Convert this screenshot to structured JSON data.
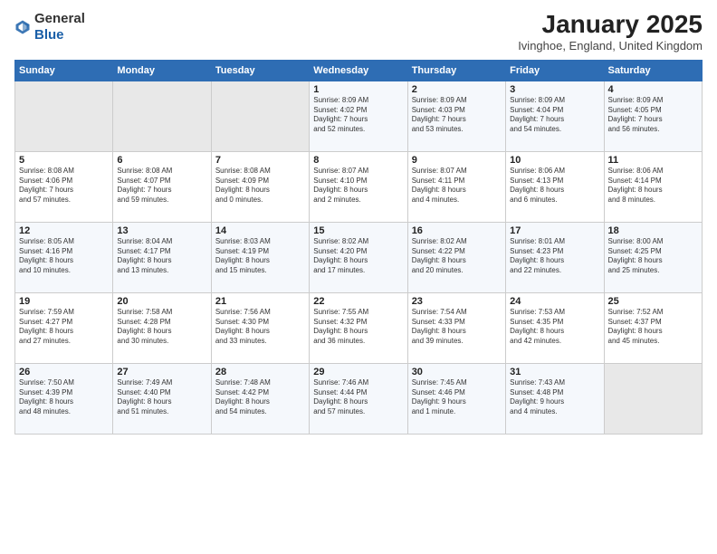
{
  "header": {
    "logo_general": "General",
    "logo_blue": "Blue",
    "title": "January 2025",
    "location": "Ivinghoe, England, United Kingdom"
  },
  "weekdays": [
    "Sunday",
    "Monday",
    "Tuesday",
    "Wednesday",
    "Thursday",
    "Friday",
    "Saturday"
  ],
  "weeks": [
    [
      {
        "day": "",
        "info": ""
      },
      {
        "day": "",
        "info": ""
      },
      {
        "day": "",
        "info": ""
      },
      {
        "day": "1",
        "info": "Sunrise: 8:09 AM\nSunset: 4:02 PM\nDaylight: 7 hours\nand 52 minutes."
      },
      {
        "day": "2",
        "info": "Sunrise: 8:09 AM\nSunset: 4:03 PM\nDaylight: 7 hours\nand 53 minutes."
      },
      {
        "day": "3",
        "info": "Sunrise: 8:09 AM\nSunset: 4:04 PM\nDaylight: 7 hours\nand 54 minutes."
      },
      {
        "day": "4",
        "info": "Sunrise: 8:09 AM\nSunset: 4:05 PM\nDaylight: 7 hours\nand 56 minutes."
      }
    ],
    [
      {
        "day": "5",
        "info": "Sunrise: 8:08 AM\nSunset: 4:06 PM\nDaylight: 7 hours\nand 57 minutes."
      },
      {
        "day": "6",
        "info": "Sunrise: 8:08 AM\nSunset: 4:07 PM\nDaylight: 7 hours\nand 59 minutes."
      },
      {
        "day": "7",
        "info": "Sunrise: 8:08 AM\nSunset: 4:09 PM\nDaylight: 8 hours\nand 0 minutes."
      },
      {
        "day": "8",
        "info": "Sunrise: 8:07 AM\nSunset: 4:10 PM\nDaylight: 8 hours\nand 2 minutes."
      },
      {
        "day": "9",
        "info": "Sunrise: 8:07 AM\nSunset: 4:11 PM\nDaylight: 8 hours\nand 4 minutes."
      },
      {
        "day": "10",
        "info": "Sunrise: 8:06 AM\nSunset: 4:13 PM\nDaylight: 8 hours\nand 6 minutes."
      },
      {
        "day": "11",
        "info": "Sunrise: 8:06 AM\nSunset: 4:14 PM\nDaylight: 8 hours\nand 8 minutes."
      }
    ],
    [
      {
        "day": "12",
        "info": "Sunrise: 8:05 AM\nSunset: 4:16 PM\nDaylight: 8 hours\nand 10 minutes."
      },
      {
        "day": "13",
        "info": "Sunrise: 8:04 AM\nSunset: 4:17 PM\nDaylight: 8 hours\nand 13 minutes."
      },
      {
        "day": "14",
        "info": "Sunrise: 8:03 AM\nSunset: 4:19 PM\nDaylight: 8 hours\nand 15 minutes."
      },
      {
        "day": "15",
        "info": "Sunrise: 8:02 AM\nSunset: 4:20 PM\nDaylight: 8 hours\nand 17 minutes."
      },
      {
        "day": "16",
        "info": "Sunrise: 8:02 AM\nSunset: 4:22 PM\nDaylight: 8 hours\nand 20 minutes."
      },
      {
        "day": "17",
        "info": "Sunrise: 8:01 AM\nSunset: 4:23 PM\nDaylight: 8 hours\nand 22 minutes."
      },
      {
        "day": "18",
        "info": "Sunrise: 8:00 AM\nSunset: 4:25 PM\nDaylight: 8 hours\nand 25 minutes."
      }
    ],
    [
      {
        "day": "19",
        "info": "Sunrise: 7:59 AM\nSunset: 4:27 PM\nDaylight: 8 hours\nand 27 minutes."
      },
      {
        "day": "20",
        "info": "Sunrise: 7:58 AM\nSunset: 4:28 PM\nDaylight: 8 hours\nand 30 minutes."
      },
      {
        "day": "21",
        "info": "Sunrise: 7:56 AM\nSunset: 4:30 PM\nDaylight: 8 hours\nand 33 minutes."
      },
      {
        "day": "22",
        "info": "Sunrise: 7:55 AM\nSunset: 4:32 PM\nDaylight: 8 hours\nand 36 minutes."
      },
      {
        "day": "23",
        "info": "Sunrise: 7:54 AM\nSunset: 4:33 PM\nDaylight: 8 hours\nand 39 minutes."
      },
      {
        "day": "24",
        "info": "Sunrise: 7:53 AM\nSunset: 4:35 PM\nDaylight: 8 hours\nand 42 minutes."
      },
      {
        "day": "25",
        "info": "Sunrise: 7:52 AM\nSunset: 4:37 PM\nDaylight: 8 hours\nand 45 minutes."
      }
    ],
    [
      {
        "day": "26",
        "info": "Sunrise: 7:50 AM\nSunset: 4:39 PM\nDaylight: 8 hours\nand 48 minutes."
      },
      {
        "day": "27",
        "info": "Sunrise: 7:49 AM\nSunset: 4:40 PM\nDaylight: 8 hours\nand 51 minutes."
      },
      {
        "day": "28",
        "info": "Sunrise: 7:48 AM\nSunset: 4:42 PM\nDaylight: 8 hours\nand 54 minutes."
      },
      {
        "day": "29",
        "info": "Sunrise: 7:46 AM\nSunset: 4:44 PM\nDaylight: 8 hours\nand 57 minutes."
      },
      {
        "day": "30",
        "info": "Sunrise: 7:45 AM\nSunset: 4:46 PM\nDaylight: 9 hours\nand 1 minute."
      },
      {
        "day": "31",
        "info": "Sunrise: 7:43 AM\nSunset: 4:48 PM\nDaylight: 9 hours\nand 4 minutes."
      },
      {
        "day": "",
        "info": ""
      }
    ]
  ]
}
